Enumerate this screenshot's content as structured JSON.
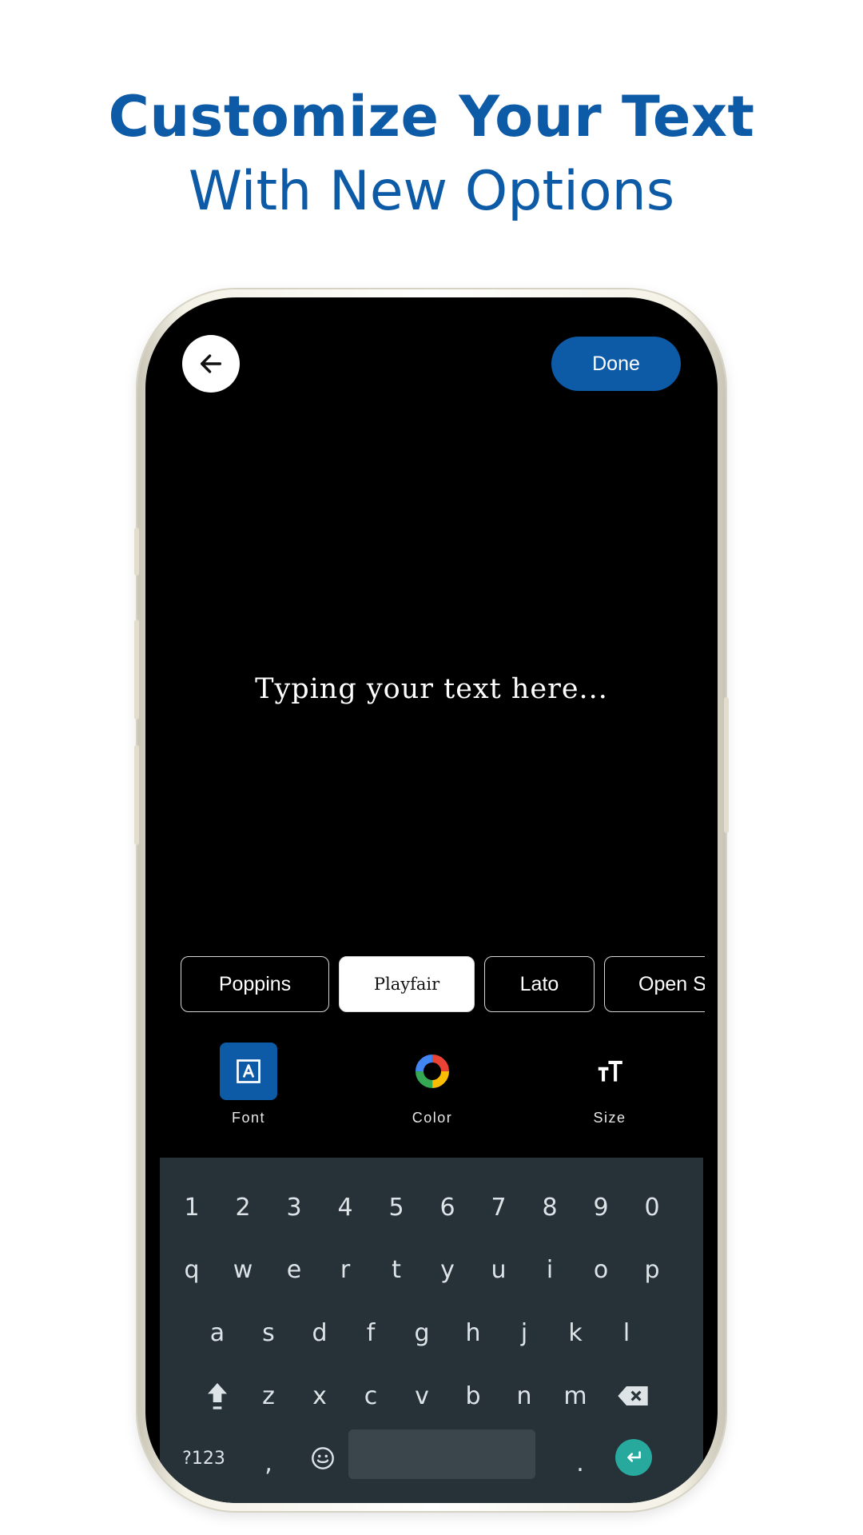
{
  "headline": {
    "line1": "Customize Your Text",
    "line2": "With New Options"
  },
  "topbar": {
    "back_icon": "arrow-left-icon",
    "done_label": "Done"
  },
  "canvas": {
    "placeholder_text": "Typing your text here..."
  },
  "fonts": {
    "options": [
      "Poppins",
      "Playfair",
      "Lato",
      "Open Sans"
    ],
    "selected": "Playfair"
  },
  "tools": [
    {
      "label": "Font",
      "icon": "font-icon",
      "active": true
    },
    {
      "label": "Color",
      "icon": "color-wheel-icon",
      "active": false
    },
    {
      "label": "Size",
      "icon": "text-size-icon",
      "active": false
    }
  ],
  "keyboard": {
    "row_numbers": [
      "1",
      "2",
      "3",
      "4",
      "5",
      "6",
      "7",
      "8",
      "9",
      "0"
    ],
    "row_top": [
      "q",
      "w",
      "e",
      "r",
      "t",
      "y",
      "u",
      "i",
      "o",
      "p"
    ],
    "row_middle": [
      "a",
      "s",
      "d",
      "f",
      "g",
      "h",
      "j",
      "k",
      "l"
    ],
    "row_bottom": [
      "z",
      "x",
      "c",
      "v",
      "b",
      "n",
      "m"
    ],
    "symbols_label": "?123",
    "comma": ",",
    "period": ".",
    "emoji_icon": "emoji-icon",
    "shift_icon": "shift-icon",
    "backspace_icon": "backspace-icon",
    "enter_icon": "enter-icon"
  },
  "colors": {
    "brand": "#0d5aa7",
    "screen_bg": "#000000",
    "keyboard_bg": "#263238",
    "enter_key": "#27a99d"
  }
}
